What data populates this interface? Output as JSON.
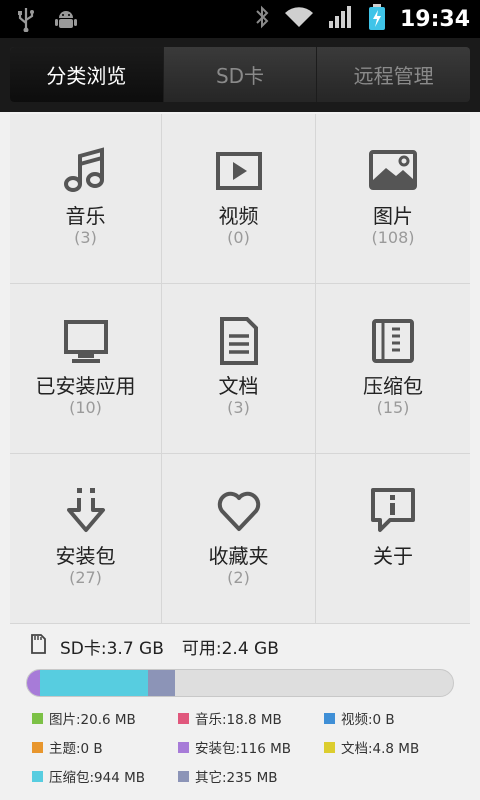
{
  "status_bar": {
    "time": "19:34"
  },
  "tabs": [
    {
      "label": "分类浏览",
      "active": true
    },
    {
      "label": "SD卡",
      "active": false
    },
    {
      "label": "远程管理",
      "active": false
    }
  ],
  "categories": [
    {
      "label": "音乐",
      "count": "(3)",
      "icon": "music-note-icon"
    },
    {
      "label": "视频",
      "count": "(0)",
      "icon": "video-play-icon"
    },
    {
      "label": "图片",
      "count": "(108)",
      "icon": "picture-icon"
    },
    {
      "label": "已安装应用",
      "count": "(10)",
      "icon": "monitor-icon"
    },
    {
      "label": "文档",
      "count": "(3)",
      "icon": "document-icon"
    },
    {
      "label": "压缩包",
      "count": "(15)",
      "icon": "archive-icon"
    },
    {
      "label": "安装包",
      "count": "(27)",
      "icon": "download-arrow-icon"
    },
    {
      "label": "收藏夹",
      "count": "(2)",
      "icon": "heart-icon"
    },
    {
      "label": "关于",
      "count": "",
      "icon": "info-bubble-icon"
    }
  ],
  "storage": {
    "sd_label": "SD卡:3.7 GB",
    "free_label": "可用:2.4 GB",
    "usage_bar": [
      {
        "key": "apk",
        "color": "#a77bd8",
        "fraction": 0.03
      },
      {
        "key": "archive",
        "color": "#57cde0",
        "fraction": 0.255
      },
      {
        "key": "other",
        "color": "#8c94b7",
        "fraction": 0.063
      }
    ],
    "legend": [
      {
        "label": "图片:20.6 MB",
        "color": "#7cc146"
      },
      {
        "label": "音乐:18.8 MB",
        "color": "#e0577c"
      },
      {
        "label": "视频:0 B",
        "color": "#3f8fd6"
      },
      {
        "label": "主题:0 B",
        "color": "#e8962d"
      },
      {
        "label": "安装包:116 MB",
        "color": "#a77bd8"
      },
      {
        "label": "文档:4.8 MB",
        "color": "#dccd2e"
      },
      {
        "label": "压缩包:944 MB",
        "color": "#57cde0"
      },
      {
        "label": "其它:235 MB",
        "color": "#8c94b7"
      }
    ]
  }
}
